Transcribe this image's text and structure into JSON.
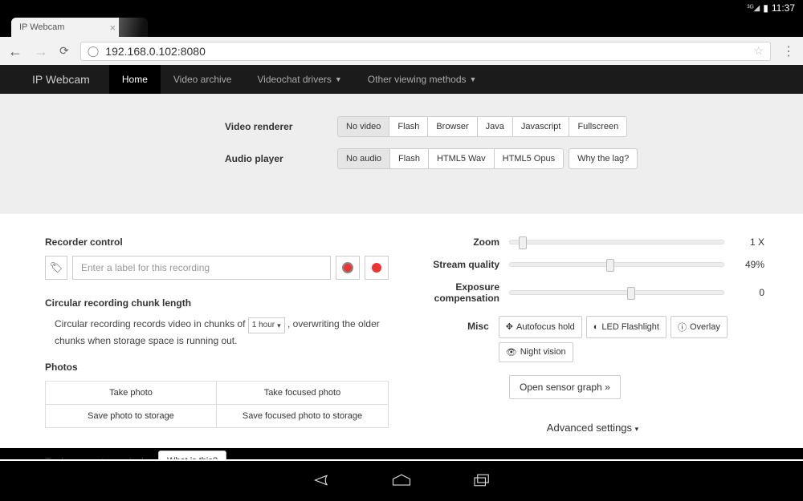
{
  "statusbar": {
    "time": "11:37"
  },
  "browser": {
    "tab_title": "IP Webcam",
    "url": "192.168.0.102:8080"
  },
  "nav": {
    "brand": "IP Webcam",
    "home": "Home",
    "archive": "Video archive",
    "drivers": "Videochat drivers",
    "other": "Other viewing methods"
  },
  "renderer": {
    "label": "Video renderer",
    "opts": [
      "No video",
      "Flash",
      "Browser",
      "Java",
      "Javascript",
      "Fullscreen"
    ]
  },
  "audio": {
    "label": "Audio player",
    "opts": [
      "No audio",
      "Flash",
      "HTML5 Wav",
      "HTML5 Opus"
    ],
    "whylag": "Why the lag?"
  },
  "recorder": {
    "heading": "Recorder control",
    "placeholder": "Enter a label for this recording"
  },
  "chunk": {
    "heading": "Circular recording chunk length",
    "pre": "Circular recording records video in chunks of ",
    "sel": "1 hour",
    "post": ", overwriting the older chunks when storage space is running out."
  },
  "photos": {
    "heading": "Photos",
    "take": "Take photo",
    "take_focused": "Take focused photo",
    "save": "Save photo to storage",
    "save_focused": "Save focused photo to storage"
  },
  "tasker": {
    "label": "Tasker events control",
    "what": "What is this?"
  },
  "sliders": {
    "zoom": {
      "label": "Zoom",
      "value": "1 X",
      "pos": 4
    },
    "quality": {
      "label": "Stream quality",
      "value": "49%",
      "pos": 45
    },
    "exposure": {
      "label": "Exposure compensation",
      "value": "0",
      "pos": 55
    }
  },
  "misc": {
    "label": "Misc",
    "autofocus": "Autofocus hold",
    "flash": "LED Flashlight",
    "overlay": "Overlay",
    "night": "Night vision"
  },
  "sensor": "Open sensor graph »",
  "advanced": "Advanced settings"
}
